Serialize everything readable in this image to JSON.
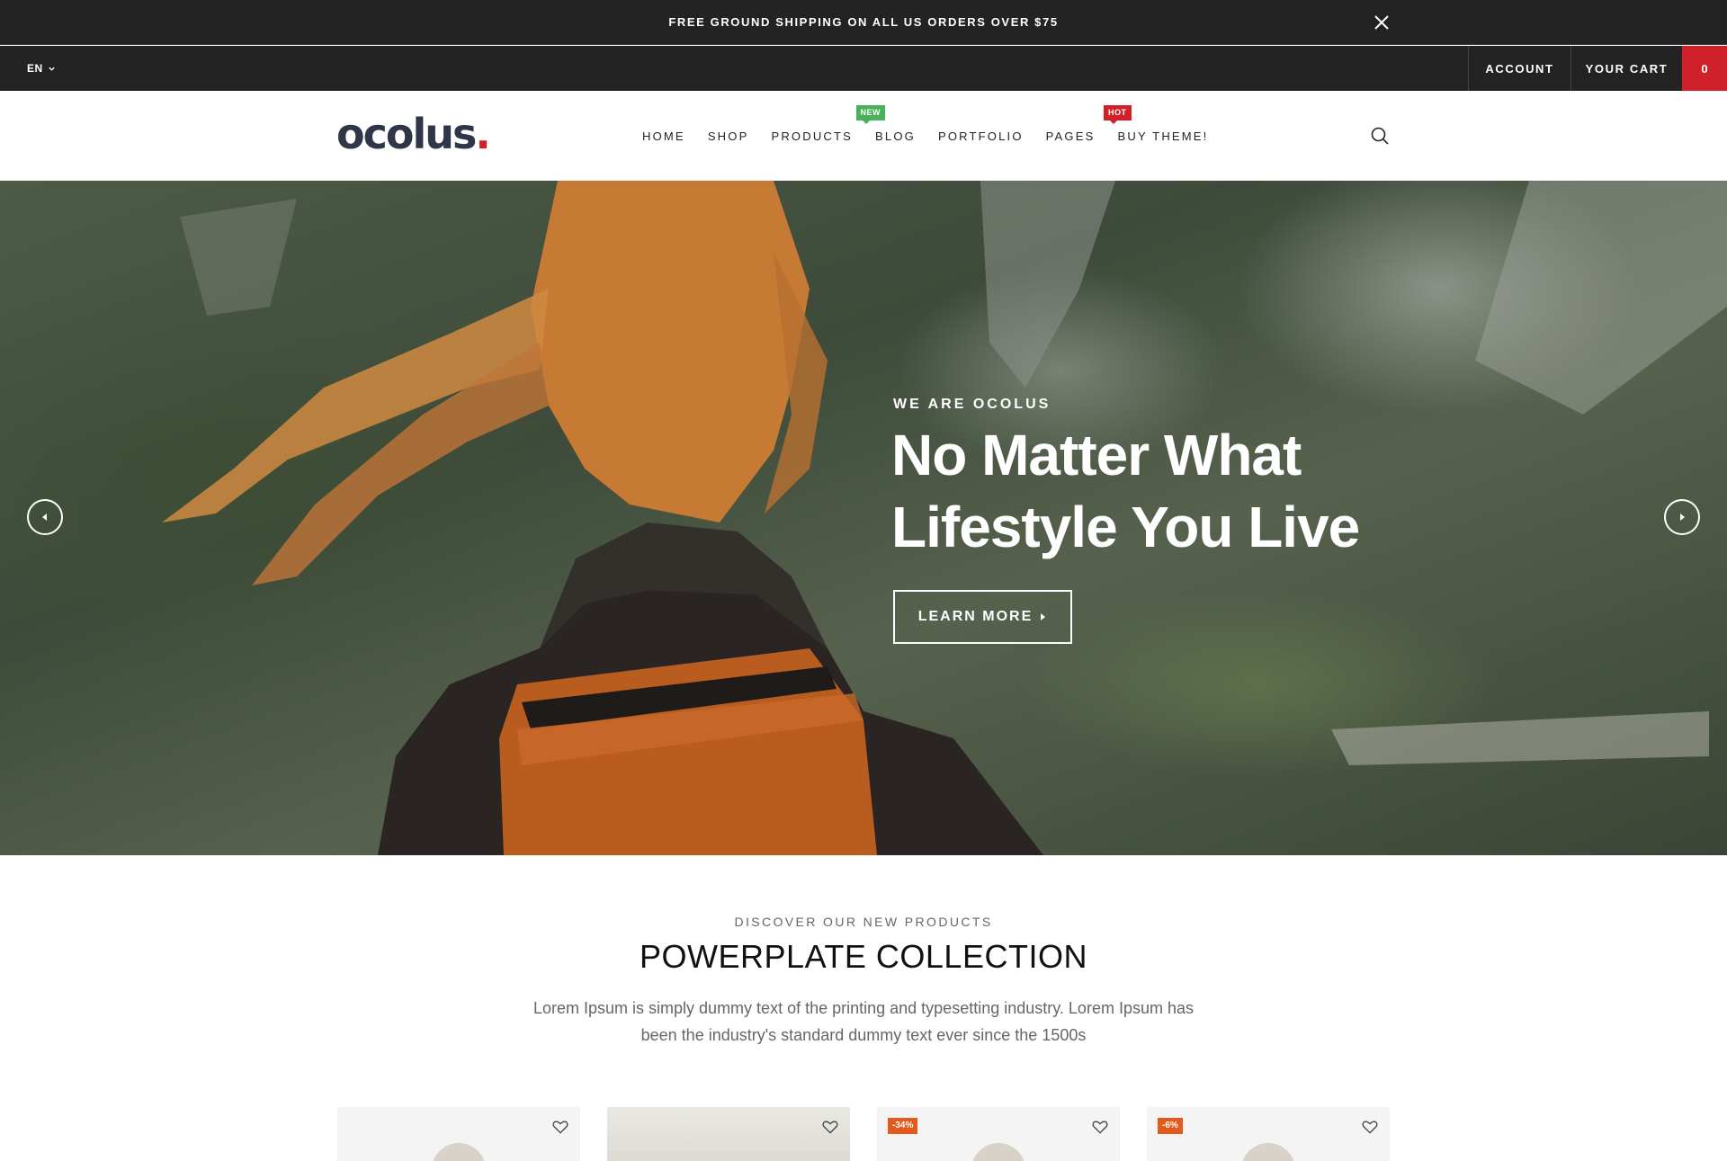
{
  "announcement": {
    "text": "FREE GROUND SHIPPING ON ALL US ORDERS OVER $75"
  },
  "utility": {
    "language": "EN",
    "account_label": "ACCOUNT",
    "cart_label": "YOUR CART",
    "cart_count": "0"
  },
  "header": {
    "logo_text": "ocolus",
    "logo_dot": ".",
    "nav": [
      {
        "label": "HOME"
      },
      {
        "label": "SHOP"
      },
      {
        "label": "PRODUCTS",
        "badge": "NEW"
      },
      {
        "label": "BLOG"
      },
      {
        "label": "PORTFOLIO"
      },
      {
        "label": "PAGES",
        "badge": "HOT"
      },
      {
        "label": "BUY THEME!"
      }
    ]
  },
  "hero": {
    "kicker": "WE ARE OCOLUS",
    "title": "No Matter What Lifestyle You Live",
    "button_label": "LEARN MORE"
  },
  "collection": {
    "kicker": "DISCOVER OUR NEW PRODUCTS",
    "title": "POWERPLATE COLLECTION",
    "description": "Lorem Ipsum is simply dummy text of the printing and typesetting industry. Lorem Ipsum has been the industry's standard dummy text ever since the 1500s",
    "products": [
      {
        "badge": ""
      },
      {
        "badge": ""
      },
      {
        "badge": "-34%"
      },
      {
        "badge": "-6%"
      }
    ]
  },
  "colors": {
    "dark_bar": "#232323",
    "accent_red": "#d0202a",
    "badge_new": "#48b15a",
    "sale_orange": "#e35b1c",
    "logo_navy": "#2e3647"
  },
  "icons": {
    "close": "close-icon",
    "chevron": "chevron-down-icon",
    "search": "search-icon",
    "prev": "arrow-left-circle-icon",
    "next": "arrow-right-circle-icon",
    "wishlist": "heart-icon",
    "caret": "caret-right-icon"
  }
}
